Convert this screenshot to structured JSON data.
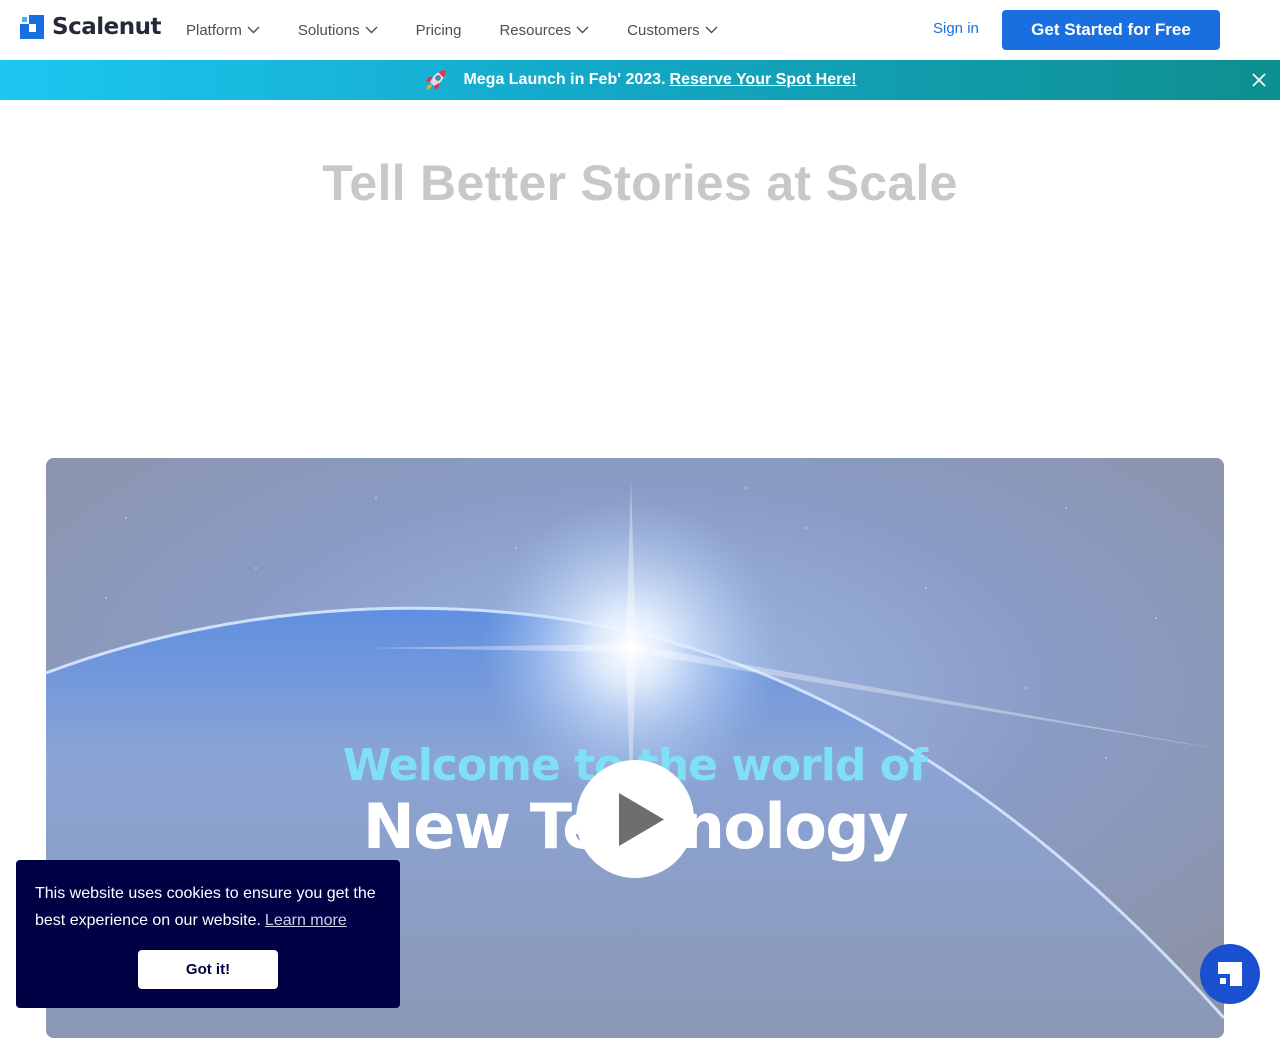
{
  "brand": {
    "name": "Scalenut",
    "color": "#1a6fe0"
  },
  "nav": {
    "items": [
      {
        "label": "Platform",
        "has_dropdown": true
      },
      {
        "label": "Solutions",
        "has_dropdown": true
      },
      {
        "label": "Pricing",
        "has_dropdown": false
      },
      {
        "label": "Resources",
        "has_dropdown": true
      },
      {
        "label": "Customers",
        "has_dropdown": true
      }
    ],
    "signin_label": "Sign in",
    "cta_label": "Get Started for Free"
  },
  "banner": {
    "icon": "rocket-icon",
    "text": "Mega Launch in Feb' 2023.",
    "link": "Reserve Your Spot Here!",
    "close_icon": "close-icon"
  },
  "hero": {
    "title_start": "Tell Better Stories at ",
    "title_highlight": "Scale"
  },
  "video": {
    "line1": "Welcome to the world of",
    "line2": "New Technology",
    "play_icon": "play-icon"
  },
  "cookie": {
    "text": "This website uses cookies to ensure you get the best experience on our website.",
    "learn_more": "Learn more",
    "button": "Got it!",
    "bg_color": "#000045"
  },
  "chat": {
    "icon": "chat-widget-icon",
    "color": "#1a4fd0"
  }
}
